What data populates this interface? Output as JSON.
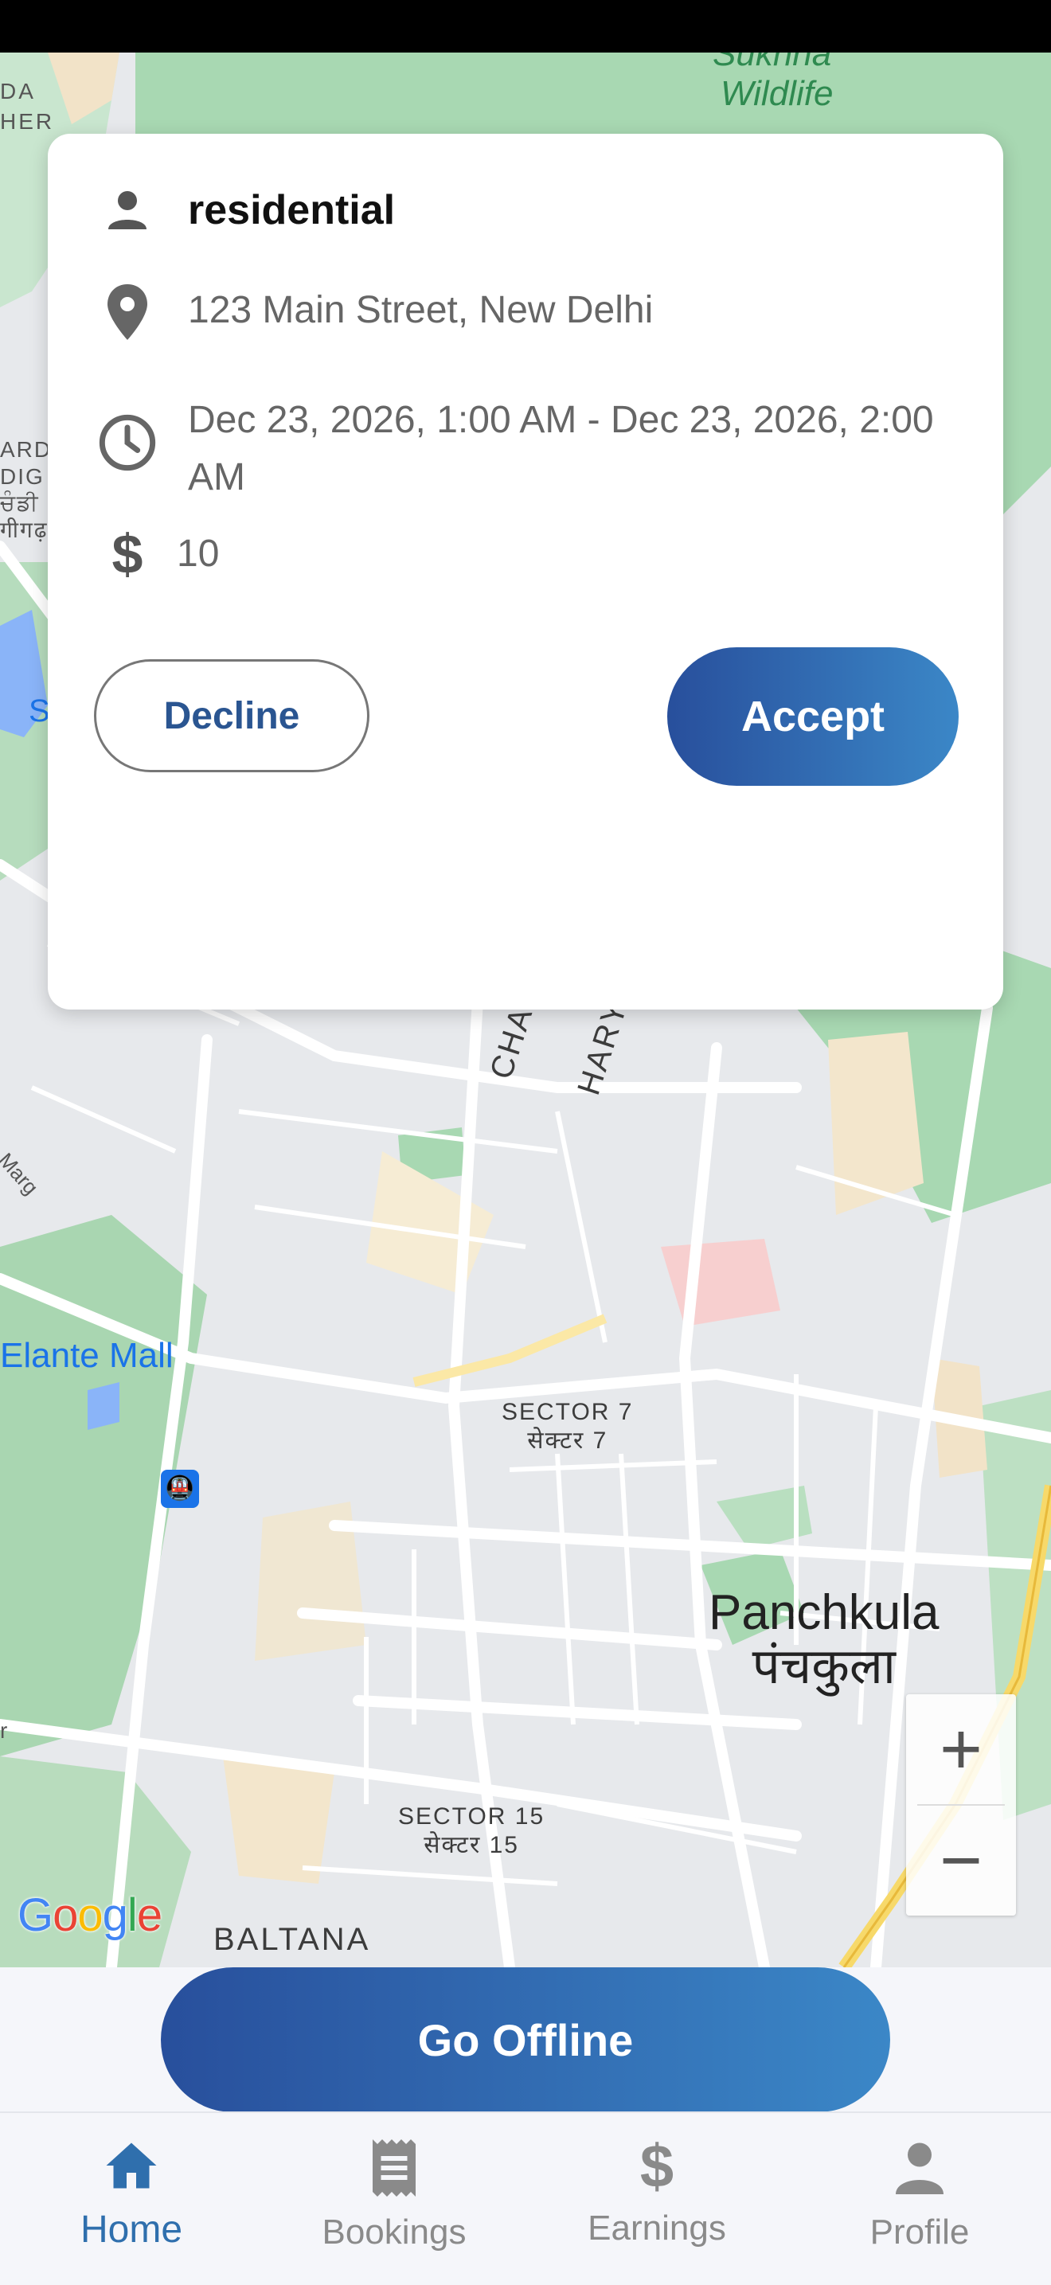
{
  "map": {
    "labels": {
      "wildlife_top": "Sukhna",
      "wildlife": "Wildlife",
      "da_her": "DA\nHER",
      "ard_dig": "ARD\nDIG\nਚੰਡੀ\nगीगढ़",
      "s_letter": "S",
      "elante": "Elante Mall",
      "marg": "a Marg",
      "chandigarh": "CHANDIGARH",
      "haryana": "HARYANA",
      "sector7": "SECTOR 7\nसेक्टर 7",
      "panchkula": "Panchkula\nपंचकुला",
      "sector15": "SECTOR 15\nसेक्टर 15",
      "baltana": "BALTANA",
      "r_letter": "r"
    },
    "google_logo": "Google",
    "zoom_in": "+",
    "zoom_out": "−"
  },
  "request_card": {
    "customer_type": "residential",
    "address": "123 Main Street, New Delhi",
    "time_range": "Dec 23, 2026, 1:00 AM - Dec 23, 2026, 2:00 AM",
    "price": "10",
    "decline_label": "Decline",
    "accept_label": "Accept"
  },
  "go_offline_label": "Go Offline",
  "bottom_nav": [
    {
      "label": "Home",
      "icon": "home-icon",
      "active": true
    },
    {
      "label": "Bookings",
      "icon": "receipt-icon",
      "active": false
    },
    {
      "label": "Earnings",
      "icon": "dollar-icon",
      "active": false
    },
    {
      "label": "Profile",
      "icon": "person-icon",
      "active": false
    }
  ],
  "colors": {
    "primary_gradient_start": "#284f9c",
    "primary_gradient_end": "#3b87c7",
    "active_nav": "#2f6fad",
    "inactive_nav": "#8a8a8a"
  }
}
